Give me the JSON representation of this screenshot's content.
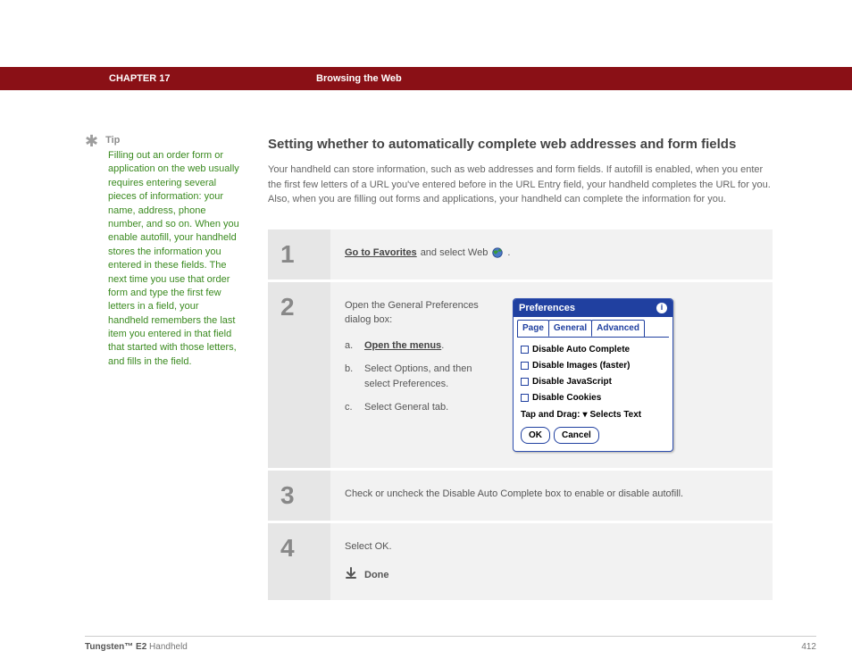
{
  "header": {
    "chapter": "CHAPTER 17",
    "title": "Browsing the Web"
  },
  "sidebar": {
    "tip_label": "Tip",
    "tip_text": "Filling out an order form or application on the web usually requires entering several pieces of information: your name, address, phone number, and so on. When you enable autofill, your handheld stores the information you entered in these fields. The next time you use that order form and type the first few letters in a field, your handheld remembers the last item you entered in that field that started with those letters, and fills in the field."
  },
  "main": {
    "heading": "Setting whether to automatically complete web addresses and form fields",
    "intro": "Your handheld can store information, such as web addresses and form fields. If autofill is enabled, when you enter the first few letters of a URL you've entered before in the URL Entry field, your handheld completes the URL for you. Also, when you are filling out forms and applications, your handheld can complete the information for you."
  },
  "steps": {
    "s1": {
      "num": "1",
      "link": "Go to Favorites",
      "rest": " and select Web "
    },
    "s2": {
      "num": "2",
      "lead": "Open the General Preferences dialog box:",
      "a_label": "a.",
      "a_link": "Open the menus",
      "a_dot": ".",
      "b_label": "b.",
      "b_text": "Select Options, and then select Preferences.",
      "c_label": "c.",
      "c_text": "Select General tab."
    },
    "s3": {
      "num": "3",
      "text": "Check or uncheck the Disable Auto Complete box to enable or disable autofill."
    },
    "s4": {
      "num": "4",
      "text": "Select OK.",
      "done": "Done"
    }
  },
  "palm": {
    "title": "Preferences",
    "tab_page": "Page",
    "tab_general": "General",
    "tab_advanced": "Advanced",
    "opt1": "Disable Auto Complete",
    "opt2": "Disable Images (faster)",
    "opt3": "Disable JavaScript",
    "opt4": "Disable Cookies",
    "drag_label": "Tap and Drag:",
    "drag_value": "Selects Text",
    "ok": "OK",
    "cancel": "Cancel"
  },
  "footer": {
    "product_bold": "Tungsten™ E2",
    "product_rest": " Handheld",
    "page": "412"
  }
}
